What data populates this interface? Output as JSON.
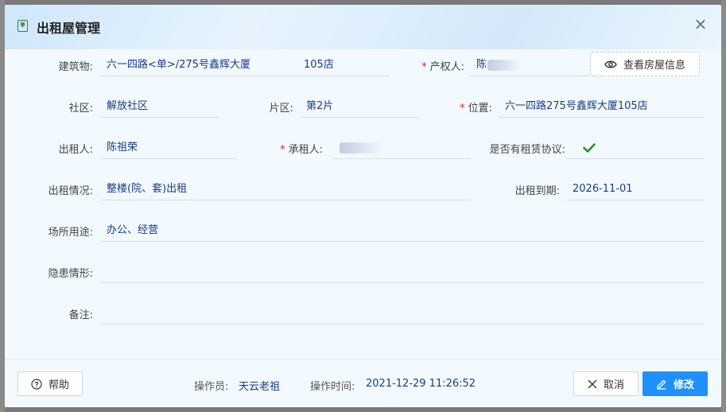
{
  "dialog": {
    "title": "出租屋管理"
  },
  "fields": {
    "building": {
      "label": "建筑物:",
      "value": "六一四路<单>/275号鑫辉大厦",
      "unit": "105店"
    },
    "owner": {
      "label": "产权人:",
      "value": "陈"
    },
    "view_house_button": "查看房屋信息",
    "community": {
      "label": "社区:",
      "value": "解放社区"
    },
    "area": {
      "label": "片区:",
      "value": "第2片"
    },
    "location": {
      "label": "位置:",
      "value": "六一四路275号鑫辉大厦105店"
    },
    "lessor": {
      "label": "出租人:",
      "value": "陈祖荣"
    },
    "tenant": {
      "label": "承租人:",
      "value": ""
    },
    "has_agreement": {
      "label": "是否有租赁协议:",
      "checked": true
    },
    "rental_status": {
      "label": "出租情况:",
      "value": "整楼(院、套)出租"
    },
    "rental_expiry": {
      "label": "出租到期:",
      "value": "2026-11-01"
    },
    "usage": {
      "label": "场所用途:",
      "value": "办公、经营"
    },
    "hazard": {
      "label": "隐患情形:",
      "value": ""
    },
    "remark": {
      "label": "备注:",
      "value": ""
    }
  },
  "footer": {
    "help_label": "帮助",
    "operator_label": "操作员:",
    "operator_value": "天云老祖",
    "op_time_label": "操作时间:",
    "op_time_value": "2021-12-29 11:26:52",
    "cancel_label": "取消",
    "save_label": "修改"
  },
  "colors": {
    "primary": "#1e90ff",
    "value_text": "#1a3a8f",
    "required": "#e02020",
    "check": "#2e8b2e"
  }
}
